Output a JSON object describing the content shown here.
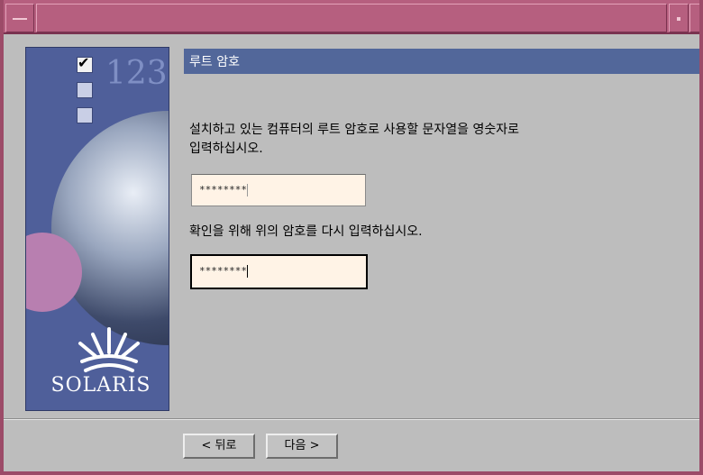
{
  "window": {
    "menu_icon": "menu-icon",
    "minimize_icon": "minimize-icon",
    "maximize_icon": "maximize-icon",
    "accent_color": "#b65f7f"
  },
  "sidebar": {
    "logo_number": "123",
    "brand": "SOLARIS",
    "steps_checked": [
      true,
      false,
      false
    ]
  },
  "page": {
    "title": "루트 암호",
    "instruction_line1": "설치하고 있는 컴퓨터의 루트 암호로 사용할 문자열을 영숫자로",
    "instruction_line2": "입력하십시오.",
    "password_value": "********",
    "confirm_instruction": "확인을 위해 위의 암호를 다시 입력하십시오.",
    "confirm_value": "********"
  },
  "buttons": {
    "back_label": "< 뒤로",
    "next_label": "다음 >"
  }
}
